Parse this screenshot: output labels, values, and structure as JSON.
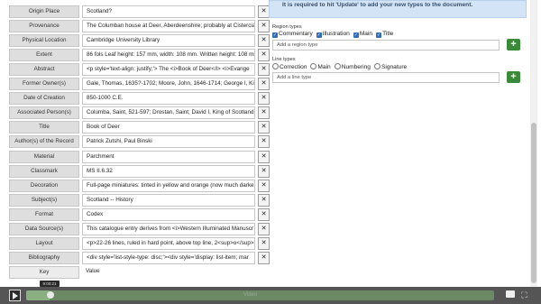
{
  "metadata_rows": [
    {
      "label": "Origin Place",
      "value": "Scotland?"
    },
    {
      "label": "Provenance",
      "value": "The Columban house at Deer, Aberdeenshire; probably at Cistercian"
    },
    {
      "label": "Physical Location",
      "value": "Cambridge University Library"
    },
    {
      "label": "Extent",
      "value": "86 fols Leaf height: 157 mm, width: 108 mm. Written height: 108 mm"
    },
    {
      "label": "Abstract",
      "value": "<p style='text-align: justify;'> The <i>Book of Deer</i> <i>Evange"
    },
    {
      "label": "Former Owner(s)",
      "value": "Gale, Thomas, 1635?-1702; Moore, John, 1646-1714; George I, Kin"
    },
    {
      "label": "Date of Creation",
      "value": "850-1000 C.E."
    },
    {
      "label": "Associated Person(s)",
      "value": "Columba, Saint, 521-597; Drostan, Saint; David I, King of Scotland,"
    },
    {
      "label": "Title",
      "value": "Book of Deer"
    },
    {
      "label": "Author(s) of the Record",
      "value": "Patrick Zutshi, Paul Binski"
    },
    {
      "label": "Material",
      "value": "Parchment"
    },
    {
      "label": "Classmark",
      "value": "MS II.6.32"
    },
    {
      "label": "Decoration",
      "value": "Full-page miniatures: tinted in yellow and orange (now much darke"
    },
    {
      "label": "Subject(s)",
      "value": "Scotland -- History"
    },
    {
      "label": "Format",
      "value": "Codex"
    },
    {
      "label": "Data Source(s)",
      "value": "This catalogue entry derives from <i>Western Illuminated Manuscr"
    },
    {
      "label": "Layout",
      "value": "<p>22-26 lines, ruled in hard point, above top line, 2<sup>o</sup>"
    },
    {
      "label": "Bibliography",
      "value": "<div style='list-style-type: disc;'><div style='display: list-item; mar"
    }
  ],
  "new_row": {
    "label": "Key",
    "value": "Value"
  },
  "delete_glyph": "✕",
  "notice": "It is required to hit 'Update' to add your new types to the document.",
  "region_types": {
    "title": "Region types",
    "options": [
      "Commentary",
      "Illustration",
      "Main",
      "Title"
    ],
    "checked": [
      true,
      true,
      true,
      true
    ],
    "input_placeholder": "Add a region type"
  },
  "line_types": {
    "title": "Line types",
    "options": [
      "Correction",
      "Main",
      "Numbering",
      "Signature"
    ],
    "checked": [
      false,
      false,
      false,
      false
    ],
    "input_placeholder": "Add a line type"
  },
  "add_glyph": "+",
  "video": {
    "time_tooltip": "9:00:21",
    "title": "Video",
    "progress": 0.05
  }
}
